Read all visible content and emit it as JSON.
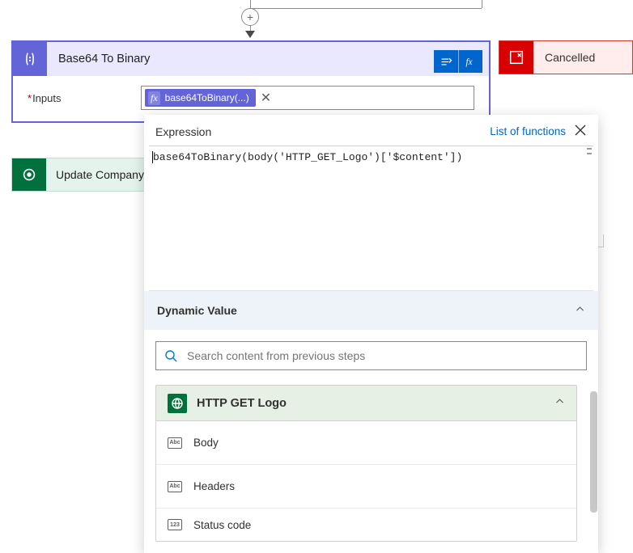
{
  "connector": {
    "add_label": "+"
  },
  "cancelled": {
    "label": "Cancelled"
  },
  "base64": {
    "title": "Base64 To Binary",
    "inputs_label": "Inputs",
    "token_label": "base64ToBinary(...)"
  },
  "update_company": {
    "label": "Update Company"
  },
  "expression_panel": {
    "title": "Expression",
    "link": "List of functions",
    "code": "base64ToBinary(body('HTTP_GET_Logo')['$content'])"
  },
  "dynamic_value": {
    "title": "Dynamic Value",
    "search_placeholder": "Search content from previous steps",
    "group": {
      "name": "HTTP GET Logo",
      "items": [
        {
          "label": "Body",
          "iconText": "Abc"
        },
        {
          "label": "Headers",
          "iconText": "Abc"
        },
        {
          "label": "Status code",
          "iconText": "123"
        }
      ]
    }
  },
  "colors": {
    "accent_purple": "#6264d7",
    "accent_blue": "#0066ce",
    "danger_red": "#d80000",
    "success_green": "#00703c"
  }
}
